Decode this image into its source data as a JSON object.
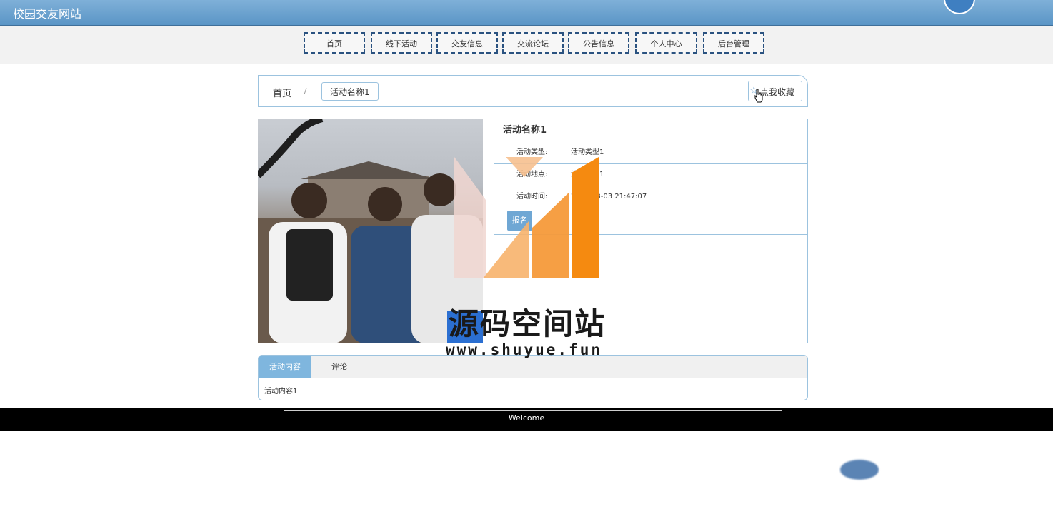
{
  "header": {
    "site_title": "校园交友网站"
  },
  "nav": {
    "items": [
      "首页",
      "线下活动",
      "交友信息",
      "交流论坛",
      "公告信息",
      "个人中心",
      "后台管理"
    ]
  },
  "breadcrumb": {
    "home": "首页",
    "separator": "/",
    "current": "活动名称1"
  },
  "favorite_button": {
    "label": "点我收藏"
  },
  "detail": {
    "title": "活动名称1",
    "rows": [
      {
        "key": "活动类型:",
        "value": "活动类型1"
      },
      {
        "key": "活动地点:",
        "value": "活动地点1"
      },
      {
        "key": "活动时间:",
        "value": "2023-03-03 21:47:07"
      }
    ],
    "signup_label": "报名"
  },
  "tabs": {
    "items": [
      "活动内容",
      "评论"
    ],
    "active": "活动内容",
    "content": "活动内容1"
  },
  "footer": {
    "text": "Welcome"
  },
  "watermark": {
    "text": "源码空间站",
    "url": "www.shuyue.fun"
  },
  "colors": {
    "header": "#5a95c6",
    "accent": "#7fb6de",
    "border": "#9cc3df"
  }
}
